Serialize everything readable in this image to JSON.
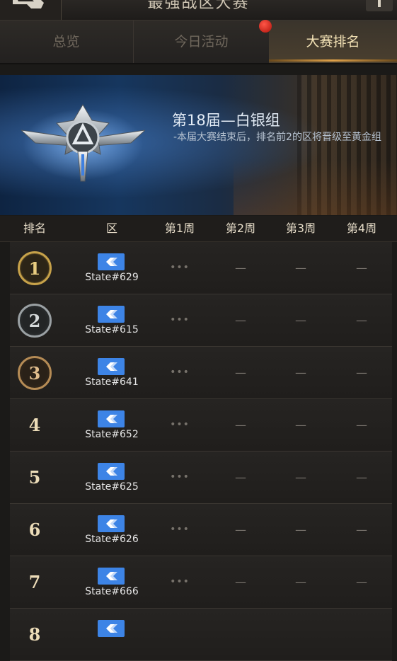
{
  "header": {
    "title": "最强战区大赛"
  },
  "tabs": [
    {
      "label": "总览",
      "active": false
    },
    {
      "label": "今日活动",
      "active": false,
      "badge": true
    },
    {
      "label": "大赛排名",
      "active": true
    }
  ],
  "banner": {
    "title": "第18届—白银组",
    "description": "-本届大赛结束后，排名前2的区将晋级至黄金组"
  },
  "table": {
    "headers": [
      "排名",
      "区",
      "第1周",
      "第2周",
      "第3周",
      "第4周"
    ],
    "rows": [
      {
        "rank": "1",
        "medal": "gold",
        "zone": "State#629",
        "w1": "•••",
        "w2": "—",
        "w3": "—",
        "w4": "—"
      },
      {
        "rank": "2",
        "medal": "silver",
        "zone": "State#615",
        "w1": "•••",
        "w2": "—",
        "w3": "—",
        "w4": "—"
      },
      {
        "rank": "3",
        "medal": "bronze",
        "zone": "State#641",
        "w1": "•••",
        "w2": "—",
        "w3": "—",
        "w4": "—"
      },
      {
        "rank": "4",
        "medal": "",
        "zone": "State#652",
        "w1": "•••",
        "w2": "—",
        "w3": "—",
        "w4": "—"
      },
      {
        "rank": "5",
        "medal": "",
        "zone": "State#625",
        "w1": "•••",
        "w2": "—",
        "w3": "—",
        "w4": "—"
      },
      {
        "rank": "6",
        "medal": "",
        "zone": "State#626",
        "w1": "•••",
        "w2": "—",
        "w3": "—",
        "w4": "—"
      },
      {
        "rank": "7",
        "medal": "",
        "zone": "State#666",
        "w1": "•••",
        "w2": "—",
        "w3": "—",
        "w4": "—"
      },
      {
        "rank": "8",
        "medal": "",
        "zone": "",
        "w1": "",
        "w2": "",
        "w3": "",
        "w4": ""
      }
    ]
  },
  "colors": {
    "accent": "#e0a24a",
    "zone_icon": "#3d84e6",
    "badge": "#d4261a"
  }
}
